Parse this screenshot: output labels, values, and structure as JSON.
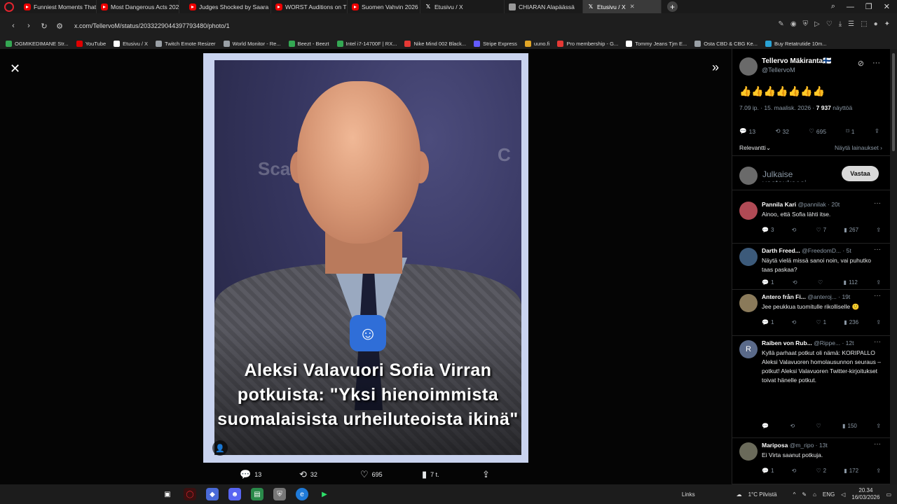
{
  "browser": {
    "tabs": [
      {
        "label": "Funniest Moments That M",
        "icon": "youtube-icon"
      },
      {
        "label": "Most Dangerous Acts 202",
        "icon": "youtube-icon"
      },
      {
        "label": "Judges Shocked by Saara",
        "icon": "youtube-icon"
      },
      {
        "label": "WORST Auditions on The",
        "icon": "youtube-icon"
      },
      {
        "label": "Suomen Vahvin 2026 - Me",
        "icon": "youtube-icon"
      },
      {
        "label": "Etusivu / X",
        "icon": "x-icon"
      },
      {
        "label": "CHIARAN Alapäässä",
        "icon": "page-icon"
      },
      {
        "label": "Etusivu / X",
        "icon": "x-icon",
        "active": true
      }
    ],
    "url": "x.com/TellervoM/status/2033229044397793480/photo/1",
    "bookmarks": [
      {
        "label": "OGMIKEDIMANE Str...",
        "color": "#34a853"
      },
      {
        "label": "YouTube",
        "color": "#e00000"
      },
      {
        "label": "Etusivu / X",
        "color": "#ffffff"
      },
      {
        "label": "Twitch Emote Resizer",
        "color": "#9aa0a6"
      },
      {
        "label": "World Monitor - Re...",
        "color": "#9aa0a6"
      },
      {
        "label": "Beezt - Beezt",
        "color": "#34a853"
      },
      {
        "label": "Intel i7-14700F | RX...",
        "color": "#34a853"
      },
      {
        "label": "Nike Mind 002 Black...",
        "color": "#e53935"
      },
      {
        "label": "Stripe Express",
        "color": "#635bff"
      },
      {
        "label": "uuno.fi",
        "color": "#e0a526"
      },
      {
        "label": "Pro membership - G...",
        "color": "#e53935"
      },
      {
        "label": "Tommy Jeans Tjm E...",
        "color": "#ffffff"
      },
      {
        "label": "Osta CBD & CBG Ke...",
        "color": "#9aa0a6"
      },
      {
        "label": "Buy Retatrutide 10m...",
        "color": "#2aa3d6"
      }
    ]
  },
  "media": {
    "headline_lines": [
      "Aleksi Valavuori Sofia Virran",
      "potkuista: \"Yksi hienoimmista",
      "suomalaisista urheiluteoista ikinä\""
    ],
    "actions": {
      "replies": "13",
      "reposts": "32",
      "likes": "695",
      "views": "7 t."
    }
  },
  "tweet": {
    "author_name": "Tellervo Mäkiranta🇫🇮",
    "author_handle": "@TellervoM",
    "text": "👍👍👍👍👍👍👍",
    "time": "7.09 ip. · 15. maalisk. 2026 ·",
    "views_count": "7 937",
    "views_label": "näyttöä",
    "stats": {
      "replies": "13",
      "reposts": "32",
      "likes": "695",
      "bookmarks": "1"
    },
    "sort_label": "Relevantti",
    "quotes_label": "Näytä lainaukset",
    "reply_placeholder": "Julkaise vastauksesi",
    "reply_button": "Vastaa"
  },
  "replies": [
    {
      "name": "Pannila Kari",
      "handle": "@pannilak · 20t",
      "text": "Ainoo, että Sofia lähti itse.",
      "stats": [
        "3",
        "",
        "7",
        "267"
      ],
      "avatar_color": "#b04a55"
    },
    {
      "name": "Darth Freed...",
      "handle": "@FreedomD... · 5t",
      "text": "Näytä vielä missä sanoi noin, vai puhutko taas paskaa?",
      "stats": [
        "1",
        "",
        "",
        "112"
      ],
      "avatar_color": "#3c5a7a"
    },
    {
      "name": "Antero från Fi...",
      "handle": "@anteroj... · 19t",
      "text": "Jee peukkua tuomitulle rikolliselle 🙂",
      "stats": [
        "1",
        "",
        "1",
        "236"
      ],
      "avatar_color": "#8a7a5a"
    },
    {
      "name": "Raiben von Rub...",
      "handle": "@Rippe... · 12t",
      "text": "Kyllä parhaat potkut oli nämä: KORIPALLO Aleksi Valavuoren homolausunnon seuraus – potkut! Aleksi Valavuoren Twitter-kirjoitukset toivat hänelle potkut.",
      "stats": [
        "",
        "",
        "",
        "150"
      ],
      "avatar_color": "#5a6a8a",
      "initial": "R"
    },
    {
      "name": "Mariposa",
      "handle": "@m_ripo · 13t",
      "text": "Ei Virta saanut potkuja.",
      "stats": [
        "1",
        "",
        "2",
        "172"
      ],
      "avatar_color": "#6a6a5a"
    }
  ],
  "taskbar": {
    "links_label": "Links",
    "weather": "1°C Pilvistä",
    "lang": "ENG",
    "time": "20.34",
    "date": "16/03/2026"
  }
}
